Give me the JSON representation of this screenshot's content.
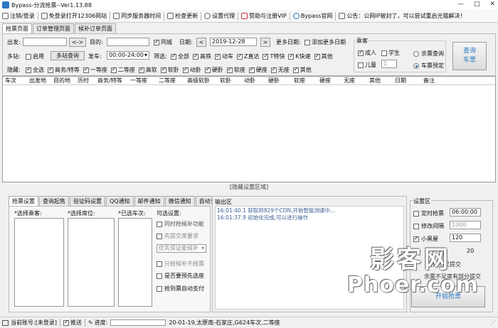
{
  "window": {
    "title": "Bypass-分流抢票--Ver1.13.88",
    "minimize": "—",
    "maximize": "□",
    "close": "✕"
  },
  "menu": [
    {
      "label": "注销/登录",
      "icon": "user-icon"
    },
    {
      "label": "免登录打开12306网站",
      "icon": "page-icon"
    },
    {
      "label": "同步服务器时间",
      "icon": "clock-icon"
    },
    {
      "label": "检查更新",
      "icon": "refresh-icon"
    },
    {
      "label": "设置代理",
      "icon": "gear-icon"
    },
    {
      "label": "赞助与注册VIP",
      "icon": "heart-icon"
    },
    {
      "label": "Bypass官网",
      "icon": "globe-icon"
    },
    {
      "label": "公告：公网IP被封了，可以尝试重启光猫解决！",
      "icon": "notice-icon"
    }
  ],
  "top_tabs": [
    "抢票页面",
    "订单管理页面",
    "候补订单页面"
  ],
  "query": {
    "from_label": "出发:",
    "swap_label": "<->",
    "to_label": "目的:",
    "same_city_label": "同城",
    "date_label": "日期:",
    "prev_label": "<",
    "date_value": "2019-12-28",
    "next_label": ">",
    "more_dates_label": "更多日期:",
    "add_dates_label": "添加更多日期",
    "multistation_label": "多站:",
    "enable_label": "启用",
    "multistation_query_label": "多站查询",
    "depart_label": "发车:",
    "depart_value": "00:00-24:00",
    "filter_label": "筛选:",
    "filters": [
      "全部",
      "高铁",
      "动车",
      "Z直达",
      "T特快",
      "K快速",
      "其他"
    ],
    "hide_label": "隐藏:",
    "hide_items": [
      "全选",
      "商务/特等",
      "一等座",
      "二等座",
      "高软",
      "软卧",
      "动卧",
      "硬卧",
      "软座",
      "硬座",
      "无座",
      "其他"
    ]
  },
  "passenger": {
    "title": "乘客",
    "adult_label": "成人",
    "student_label": "学生",
    "child_label": "儿童",
    "child_count": "1",
    "ticket_query_label": "余票查询",
    "booking_label": "车票预定",
    "search_button": "查询\n车票"
  },
  "table": {
    "columns": [
      "车次",
      "出发地",
      "目的地",
      "历时",
      "商务/特等",
      "一等座",
      "二等座",
      "高级软卧",
      "软卧",
      "动卧",
      "硬卧",
      "软座",
      "硬座",
      "无座",
      "其他",
      "日期",
      "备注"
    ]
  },
  "hide_settings_label": "[隐藏设置区域]",
  "bottom_tabs": [
    "抢票设置",
    "查询起售",
    "验证码设置",
    "QQ通知",
    "邮件通知",
    "微信通知",
    "自动支付"
  ],
  "settings": {
    "passengers_label": "*选择乘客:",
    "seats_label": "*选择席位:",
    "trains_label": "*已选车次:",
    "options_label": "可选设置:",
    "options": [
      {
        "label": "同时抢候补功能",
        "checked": false
      },
      {
        "label": "先提交席要求",
        "checked": false
      }
    ],
    "priority_dropdown": "优先保证能候补",
    "options2": [
      {
        "label": "只抢候补不抢票",
        "checked": false
      },
      {
        "label": "是否要预先选座",
        "checked": false
      },
      {
        "label": "抢到票自动支付",
        "checked": false
      }
    ]
  },
  "output": {
    "title": "输出区",
    "logs": [
      "16:01:40.1   获取到829个CDN,开始智能测速中...",
      "16:01:37.9   初始化完成,可以进行操作"
    ]
  },
  "setup": {
    "title": "设置区",
    "timed_label": "定时抢票",
    "timed_value": "06:00:00",
    "interval_label": "修改间隔",
    "interval_value": "1000",
    "blackroom_label": "小黑屋",
    "blackroom_value": "120",
    "value4": "20",
    "line5": "余票不足提交",
    "line6": "余票不足席有部分提交",
    "start_button": "开始抢票"
  },
  "watermark": {
    "line1": "影客网",
    "line2": "Phoer.com"
  },
  "status": {
    "account_label": "当前账号:[未登录]",
    "push_label": "推送",
    "progress_label": "进度:",
    "progress": 0.0,
    "train_info": "20-01-19,太原南-石家庄,G624车次,二等座"
  },
  "colors": {
    "accent": "#2b78c2",
    "log": "#3b5f96"
  }
}
